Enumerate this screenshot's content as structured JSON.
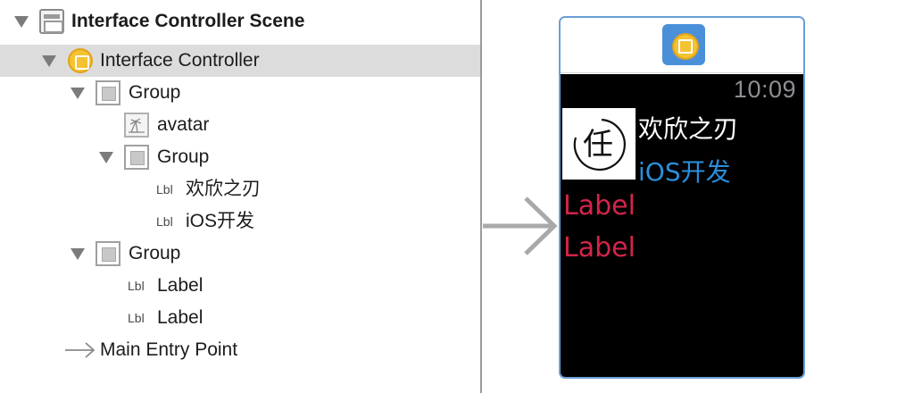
{
  "outline": {
    "rows": [
      {
        "label": "Interface Controller Scene",
        "icon": "scene-icon"
      },
      {
        "label": "Interface Controller",
        "icon": "interface-controller-icon"
      },
      {
        "label": "Group",
        "icon": "group-icon"
      },
      {
        "label": "avatar",
        "icon": "image-icon"
      },
      {
        "label": "Group",
        "icon": "group-icon"
      },
      {
        "label": "欢欣之刃",
        "icon": "label-icon"
      },
      {
        "label": "iOS开发",
        "icon": "label-icon"
      },
      {
        "label": "Group",
        "icon": "group-icon"
      },
      {
        "label": "Label",
        "icon": "label-icon"
      },
      {
        "label": "Label",
        "icon": "label-icon"
      },
      {
        "label": "Main Entry Point",
        "icon": "entry-arrow-icon"
      }
    ],
    "lbl_badge": "Lbl",
    "selected_color": "#dcdcdc"
  },
  "watch": {
    "time": "10:09",
    "avatar_glyph": "任",
    "name": "欢欣之刃",
    "subtitle": "iOS开发",
    "label1": "Label",
    "label2": "Label",
    "colors": {
      "frame": "#6a9fd6",
      "screen": "#000000",
      "name": "#ffffff",
      "subtitle": "#2a8fdc",
      "labels": "#d2254a",
      "time": "#8e8e93"
    }
  }
}
